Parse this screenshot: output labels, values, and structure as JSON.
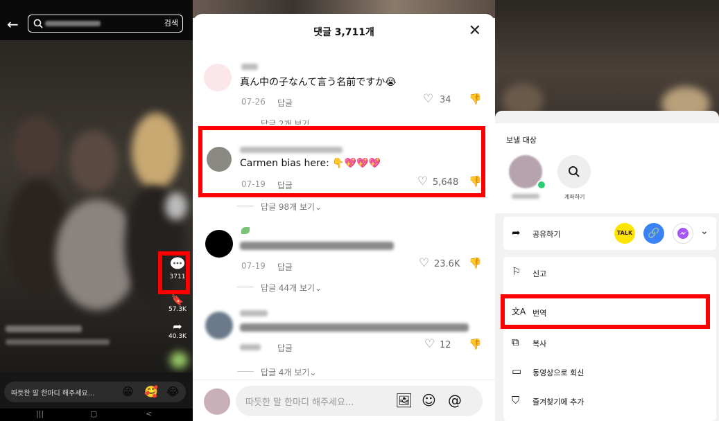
{
  "panel1": {
    "search": {
      "button_label": "검색"
    },
    "rail": {
      "comment_count": "3711",
      "bookmark_count": "57.3K",
      "share_count": "40.3K"
    },
    "input": {
      "placeholder": "따듯한 말 한마디 해주세요..."
    },
    "emojis": [
      "😁",
      "🥰",
      "😂"
    ],
    "nav": [
      "|||",
      "▢",
      "<"
    ]
  },
  "panel2": {
    "title": "댓글 3,711개",
    "close_symbol": "✕",
    "comments": [
      {
        "text": "真ん中の子なんて言う名前ですか😭",
        "date": "07-26",
        "reply_label": "답글",
        "likes": "34",
        "more_replies": "답글 2개 보기⌄"
      },
      {
        "text": "Carmen bias here: 👇💖💖💖",
        "date": "07-19",
        "reply_label": "답글",
        "likes": "5,648",
        "more_replies": "답글 98개 보기⌄"
      },
      {
        "text": "",
        "date": "07-19",
        "reply_label": "답글",
        "likes": "23.6K",
        "more_replies": "답글 44개 보기⌄"
      },
      {
        "text": "",
        "date": "",
        "reply_label": "답글",
        "likes": "12",
        "more_replies": "답글 4개 보기⌄"
      }
    ],
    "input": {
      "placeholder": "따듯한 말 한마디 해주세요..."
    }
  },
  "panel3": {
    "send_to_label": "보낼 대상",
    "search_contact_label": "계좌하기",
    "share_label": "공유하기",
    "share_icons": {
      "kakao": "TALK"
    },
    "menu": [
      {
        "icon": "flag-icon",
        "label": "신고"
      },
      {
        "icon": "translate-icon",
        "label": "번역"
      },
      {
        "icon": "copy-icon",
        "label": "복사"
      },
      {
        "icon": "video-icon",
        "label": "동영상으로 회신"
      },
      {
        "icon": "bookmark-icon",
        "label": "즐겨찾기에 추가"
      }
    ]
  },
  "colors": {
    "highlight": "#ff0000",
    "kakao": "#fee500",
    "link": "#3b82f6",
    "messenger": "#a855f7"
  }
}
